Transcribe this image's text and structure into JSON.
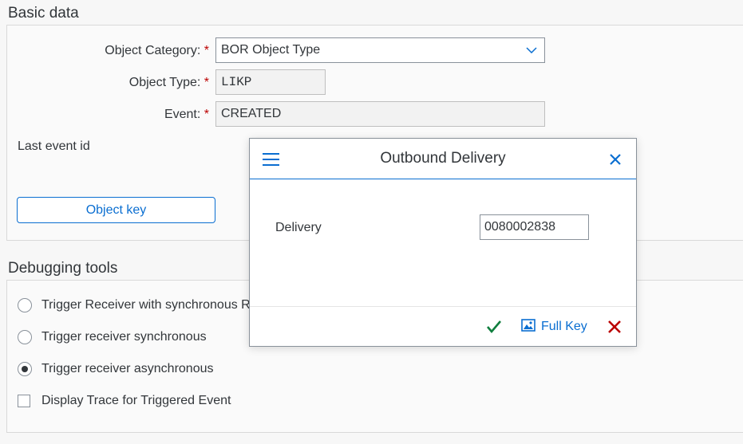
{
  "basic": {
    "title": "Basic data",
    "object_category_label": "Object Category:",
    "object_category_value": "BOR Object Type",
    "object_type_label": "Object Type:",
    "object_type_value": "LIKP",
    "event_label": "Event:",
    "event_value": "CREATED",
    "required_mark": "*",
    "last_event_label": "Last event id",
    "object_key_button": "Object key"
  },
  "debugging": {
    "title": "Debugging tools",
    "options": [
      {
        "label": "Trigger Receiver with synchronous R",
        "checked": false
      },
      {
        "label": "Trigger receiver synchronous",
        "checked": false
      },
      {
        "label": "Trigger receiver asynchronous",
        "checked": true
      }
    ],
    "trace_label": "Display Trace for Triggered Event"
  },
  "dialog": {
    "title": "Outbound Delivery",
    "delivery_label": "Delivery",
    "delivery_value": "0080002838",
    "full_key_label": "Full Key"
  },
  "icons": {
    "menu": "hamburger-icon",
    "close": "close-icon",
    "accept": "checkmark-icon",
    "full_key": "image-icon",
    "decline": "cross-icon",
    "dropdown": "chevron-down-icon"
  },
  "colors": {
    "accent": "#0a6ed1",
    "required": "#bb0000",
    "accept": "#107e3e",
    "decline": "#bb0000"
  }
}
